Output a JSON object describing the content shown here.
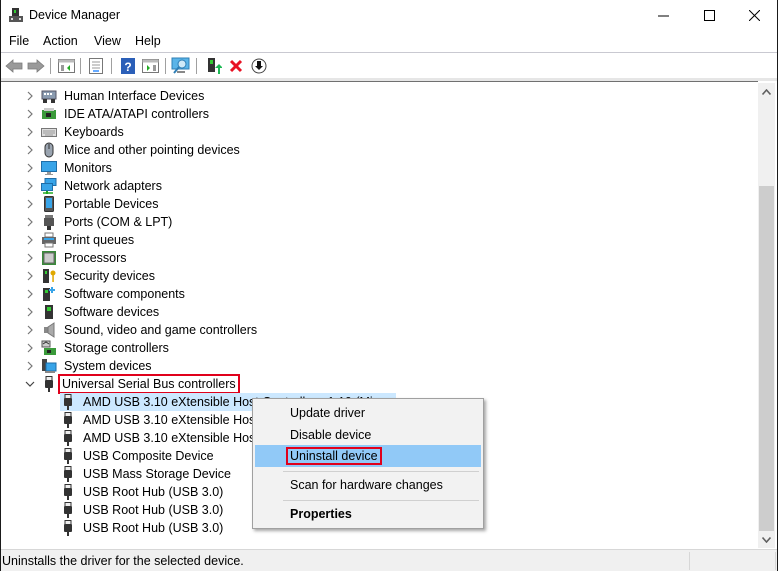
{
  "window": {
    "title": "Device Manager",
    "controls": {
      "minimize": "minimize",
      "maximize": "maximize",
      "close": "close"
    }
  },
  "menubar": {
    "items": [
      "File",
      "Action",
      "View",
      "Help"
    ]
  },
  "toolbar": {
    "buttons": [
      {
        "name": "back-icon"
      },
      {
        "name": "forward-icon"
      },
      {
        "name": "show-hide-console-tree-icon"
      },
      {
        "name": "properties-icon"
      },
      {
        "name": "help-icon"
      },
      {
        "name": "show-action-pane-icon"
      },
      {
        "name": "scan-hardware-icon"
      },
      {
        "name": "update-driver-icon"
      },
      {
        "name": "uninstall-device-icon"
      },
      {
        "name": "disable-device-icon"
      }
    ]
  },
  "tree": {
    "categories": [
      {
        "label": "Human Interface Devices",
        "icon": "hid-icon",
        "expanded": false
      },
      {
        "label": "IDE ATA/ATAPI controllers",
        "icon": "ide-controller-icon",
        "expanded": false
      },
      {
        "label": "Keyboards",
        "icon": "keyboard-icon",
        "expanded": false
      },
      {
        "label": "Mice and other pointing devices",
        "icon": "mouse-icon",
        "expanded": false
      },
      {
        "label": "Monitors",
        "icon": "monitor-icon",
        "expanded": false
      },
      {
        "label": "Network adapters",
        "icon": "network-adapter-icon",
        "expanded": false
      },
      {
        "label": "Portable Devices",
        "icon": "portable-device-icon",
        "expanded": false
      },
      {
        "label": "Ports (COM & LPT)",
        "icon": "port-icon",
        "expanded": false
      },
      {
        "label": "Print queues",
        "icon": "printer-icon",
        "expanded": false
      },
      {
        "label": "Processors",
        "icon": "processor-icon",
        "expanded": false
      },
      {
        "label": "Security devices",
        "icon": "security-device-icon",
        "expanded": false
      },
      {
        "label": "Software components",
        "icon": "software-component-icon",
        "expanded": false
      },
      {
        "label": "Software devices",
        "icon": "software-device-icon",
        "expanded": false
      },
      {
        "label": "Sound, video and game controllers",
        "icon": "speaker-icon",
        "expanded": false
      },
      {
        "label": "Storage controllers",
        "icon": "storage-controller-icon",
        "expanded": false
      },
      {
        "label": "System devices",
        "icon": "system-device-icon",
        "expanded": false
      },
      {
        "label": "Universal Serial Bus controllers",
        "icon": "usb-icon",
        "expanded": true
      }
    ],
    "usb_children": [
      {
        "label": "AMD USB 3.10 eXtensible Host Controller - 1.10 (Microsoft)",
        "selected": true
      },
      {
        "label": "AMD USB 3.10 eXtensible Host Controller - 1.10 (Microsoft)",
        "selected": false
      },
      {
        "label": "AMD USB 3.10 eXtensible Host Controller - 1.10 (Microsoft)",
        "selected": false
      },
      {
        "label": "USB Composite Device",
        "selected": false
      },
      {
        "label": "USB Mass Storage Device",
        "selected": false
      },
      {
        "label": "USB Root Hub (USB 3.0)",
        "selected": false
      },
      {
        "label": "USB Root Hub (USB 3.0)",
        "selected": false
      },
      {
        "label": "USB Root Hub (USB 3.0)",
        "selected": false
      }
    ]
  },
  "context_menu": {
    "items": [
      {
        "label": "Update driver"
      },
      {
        "label": "Disable device"
      },
      {
        "label": "Uninstall device",
        "highlighted": true
      },
      {
        "label": "Scan for hardware changes"
      },
      {
        "label": "Properties",
        "bold": true
      }
    ]
  },
  "statusbar": {
    "text": "Uninstalls the driver for the selected device."
  },
  "colors": {
    "selection": "#cce8ff",
    "menu_hover": "#91c9f7",
    "annotation_red": "#e0001b",
    "uninstall_red": "#e81123",
    "update_green": "#1db954"
  }
}
